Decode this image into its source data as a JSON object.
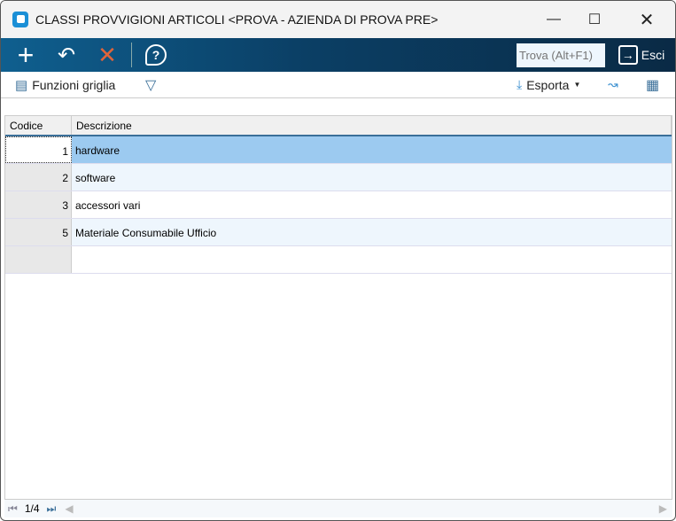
{
  "window": {
    "title": "CLASSI PROVVIGIONI ARTICOLI <PROVA - AZIENDA DI PROVA PRE>"
  },
  "toolbar": {
    "find_placeholder": "Trova (Alt+F1)",
    "exit_label": "Esci"
  },
  "subbar": {
    "grid_functions": "Funzioni griglia",
    "export": "Esporta"
  },
  "grid": {
    "columns": [
      "Codice",
      "Descrizione"
    ],
    "rows": [
      {
        "code": "1",
        "desc": "hardware"
      },
      {
        "code": "2",
        "desc": "software"
      },
      {
        "code": "3",
        "desc": "accessori vari"
      },
      {
        "code": "5",
        "desc": "Materiale Consumabile Ufficio"
      }
    ]
  },
  "footer": {
    "page": "1/4"
  }
}
